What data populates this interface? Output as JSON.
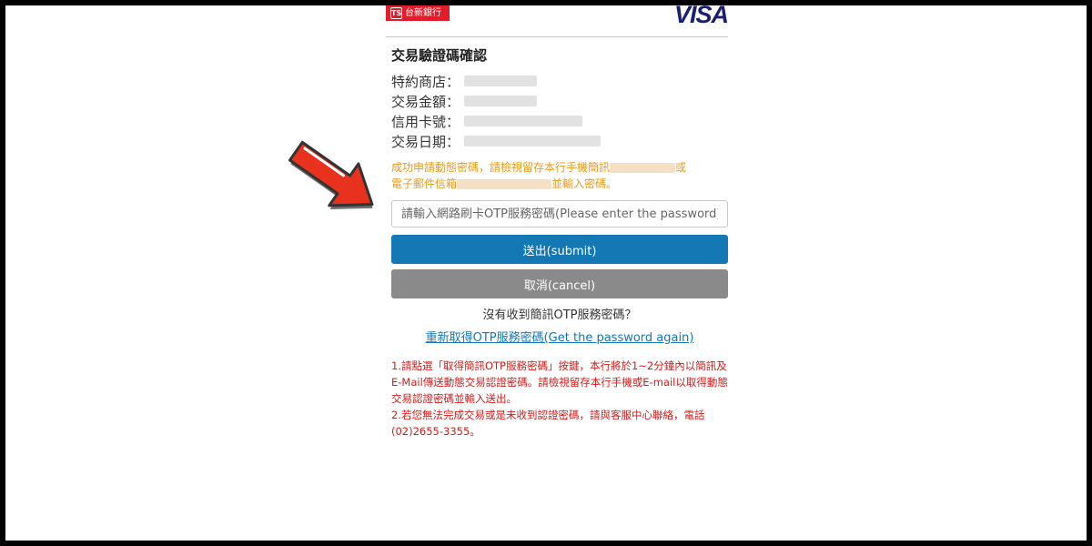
{
  "header": {
    "bank_name": "台新銀行",
    "bank_mark": "TS",
    "card_brand": "VISA"
  },
  "title": "交易驗證碼確認",
  "info": {
    "merchant_label": "特約商店：",
    "amount_label": "交易金額：",
    "card_label": "信用卡號：",
    "date_label": "交易日期："
  },
  "notice": {
    "line1": "成功申請動態密碼，請檢視留存本行手機簡訊",
    "line1_end": "或",
    "line2": "電子郵件信箱",
    "line2_end": "並輸入密碼。"
  },
  "otp_input": {
    "placeholder": "請輸入網路刷卡OTP服務密碼(Please enter the password)",
    "value": ""
  },
  "buttons": {
    "submit_label": "送出(submit)",
    "cancel_label": "取消(cancel)"
  },
  "no_sms_text": "沒有收到簡訊OTP服務密碼？",
  "resend_link": "重新取得OTP服務密碼(Get the password again)",
  "help": {
    "item1": "1.請點選「取得簡訊OTP服務密碼」按鍵，本行將於1~2分鐘內以簡訊及E-Mail傳送動態交易認證密碼。請檢視留存本行手機或E-mail以取得動態交易認證密碼並輸入送出。",
    "item2": "2.若您無法完成交易或是未收到認證密碼，請與客服中心聯絡，電話(02)2655-3355。"
  },
  "colors": {
    "primary": "#1478b5",
    "cancel": "#8a8a8a",
    "notice": "#e89a1f",
    "help": "#d51a1a",
    "bank_red": "#e01e2b",
    "visa_blue": "#1a1f71",
    "arrow_red": "#e8321e"
  }
}
